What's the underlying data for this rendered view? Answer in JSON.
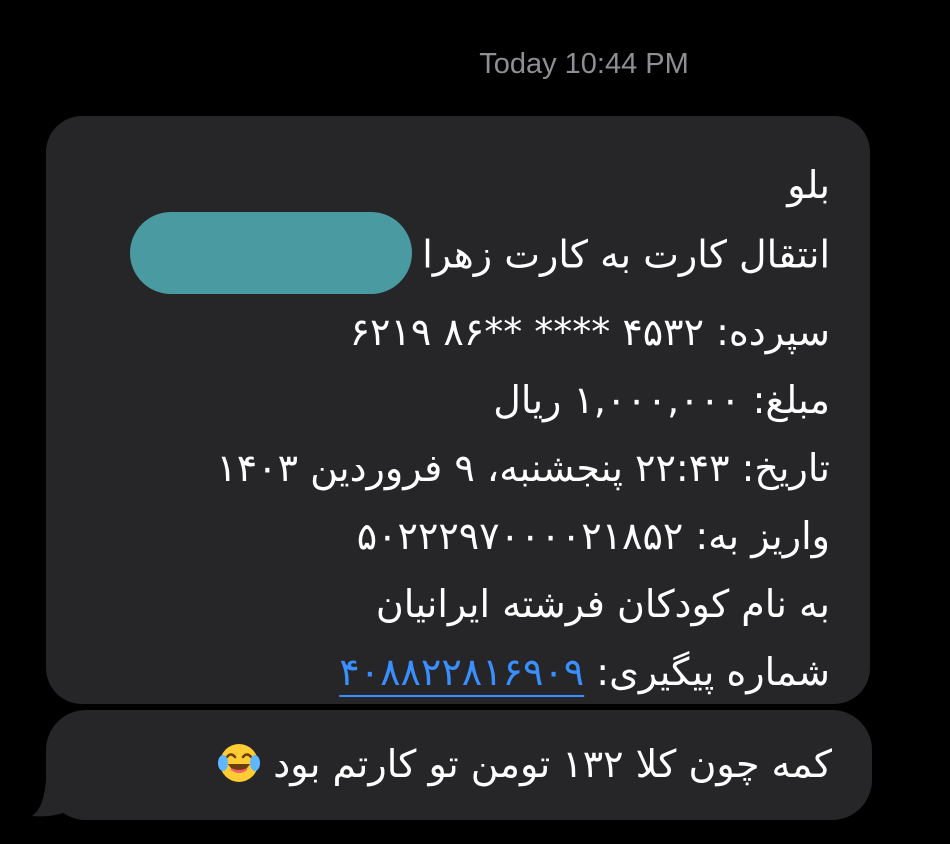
{
  "header": {
    "timestamp": "Today 10:44 PM"
  },
  "message": {
    "greeting": "بلو",
    "transfer_label": "انتقال کارت به کارت زهرا",
    "deposit_line": "سپرده: ۴۵۳۲ **** **۸۶ ۶۲۱۹",
    "amount_line": "مبلغ: ۱,۰۰۰,۰۰۰ ریال",
    "date_line": "تاریخ: ۲۲:۴۳ پنجشنبه، ۹ فروردین ۱۴۰۳",
    "destination_line": "واریز به: ۵۰۲۲۲۹۷۰۰۰۰۲۱۸۵۲",
    "recipient_line": "به نام کودکان فرشته ایرانیان",
    "tracking_label": "شماره پیگیری: ",
    "tracking_number": "۴۰۸۸۲۲۸۱۶۹۰۹",
    "redaction_icon": "redaction-blob",
    "redaction_color": "#4a9aa1",
    "link_color": "#3a8fff"
  },
  "reply": {
    "text": "کمه چون کلا ۱۳۲ تومن تو کارتم بود",
    "emoji": "tears-of-joy-emoji"
  },
  "colors": {
    "background": "#000000",
    "bubble": "#262629",
    "timestamp": "#8e8e93"
  }
}
